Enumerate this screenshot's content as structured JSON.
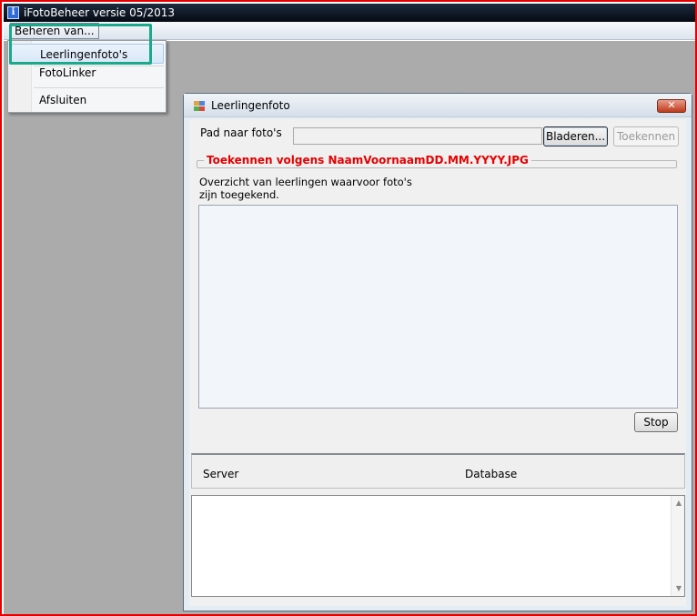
{
  "app": {
    "title": "iFotoBeheer versie 05/2013",
    "icon": "info-icon",
    "icon_glyph": "i"
  },
  "menubar": {
    "root_label": "Beheren van..."
  },
  "dropdown": {
    "items": [
      {
        "label": "Leerlingenfoto's",
        "selected": true
      },
      {
        "label": "FotoLinker",
        "selected": false
      },
      {
        "label": "Afsluiten",
        "selected": false
      }
    ]
  },
  "child_window": {
    "title": "Leerlingenfoto",
    "icon": "app-window-icon",
    "close_glyph": "✕",
    "path_label": "Pad naar foto's",
    "path_value": "",
    "browse_label": "Bladeren...",
    "assign_label": "Toekennen",
    "assign_note": "Toekennen volgens NaamVoornaamDD.MM.YYYY.JPG",
    "overview_text": "Overzicht van leerlingen waarvoor foto's zijn toegekend.",
    "stop_label": "Stop",
    "server_label": "Server",
    "database_label": "Database",
    "log_text": ""
  },
  "colors": {
    "highlight": "#1aa98a",
    "note_red": "#e60000",
    "frame_red": "#e60000"
  }
}
